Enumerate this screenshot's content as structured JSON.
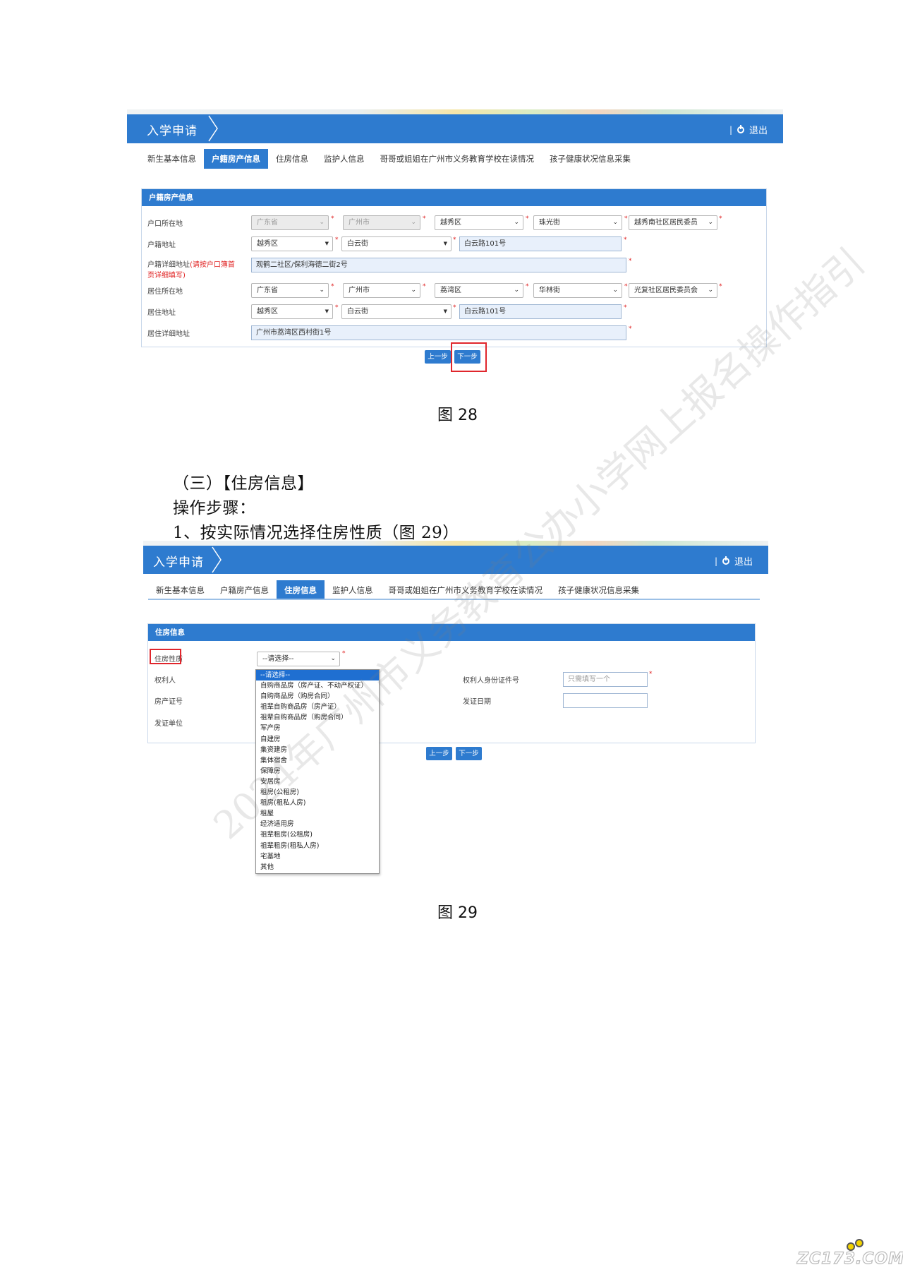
{
  "fig28": {
    "banner_title": "入学申请",
    "logout_label": "退出",
    "tabs": [
      "新生基本信息",
      "户籍房产信息",
      "住房信息",
      "监护人信息",
      "哥哥或姐姐在广州市义务教育学校在读情况",
      "孩子健康状况信息采集"
    ],
    "active_tab": "户籍房产信息",
    "panel_title": "户籍房产信息",
    "rows": {
      "hukou_location_label": "户口所在地",
      "hukou_location": [
        "广东省",
        "广州市",
        "越秀区",
        "珠光街",
        "越秀南社区居民委员"
      ],
      "hukou_address_label": "户籍地址",
      "hukou_address": [
        "越秀区",
        "白云街",
        "白云路101号"
      ],
      "hukou_detail_label": "户籍详细地址",
      "hukou_detail_note": "(请按户口簿首页详细填写)",
      "hukou_detail": "观鹤二社区/保利海德二街2号",
      "residence_location_label": "居住所在地",
      "residence_location": [
        "广东省",
        "广州市",
        "荔湾区",
        "华林街",
        "光复社区居民委员会"
      ],
      "residence_address_label": "居住地址",
      "residence_address": [
        "越秀区",
        "白云街",
        "白云路101号"
      ],
      "residence_detail_label": "居住详细地址",
      "residence_detail": "广州市荔湾区西村街1号"
    },
    "btn_prev": "上一步",
    "btn_next": "下一步",
    "caption": "图 28"
  },
  "section_heading": "（三）【住房信息】",
  "steps_heading": "操作步骤：",
  "step1": "1、按实际情况选择住房性质（图 29）",
  "fig29": {
    "banner_title": "入学申请",
    "logout_label": "退出",
    "tabs": [
      "新生基本信息",
      "户籍房产信息",
      "住房信息",
      "监护人信息",
      "哥哥或姐姐在广州市义务教育学校在读情况",
      "孩子健康状况信息采集"
    ],
    "active_tab": "住房信息",
    "panel_title": "住房信息",
    "housing_type_label": "住房性质",
    "housing_type_value": "--请选择--",
    "owner_label": "权利人",
    "cert_no_label": "房产证号",
    "issuer_label": "发证单位",
    "owner_id_label": "权利人身份证件号",
    "owner_id_placeholder": "只需填写一个",
    "issue_date_label": "发证日期",
    "options": [
      "--请选择--",
      "自购商品房（房产证、不动产权证）",
      "自购商品房（购房合同）",
      "祖辈自购商品房（房产证）",
      "祖辈自购商品房（购房合同）",
      "军产房",
      "自建房",
      "集资建房",
      "集体宿舍",
      "保障房",
      "安居房",
      "租房(公租房)",
      "租房(租私人房)",
      "租屋",
      "经济适用房",
      "祖辈租房(公租房)",
      "祖辈租房(租私人房)",
      "宅基地",
      "其他"
    ],
    "btn_prev": "上一步",
    "btn_next": "下一步",
    "caption": "图 29"
  },
  "watermark": "2024年广州市义务教育公办小学网上报名操作指引",
  "site_logo": "ZC173.COM"
}
